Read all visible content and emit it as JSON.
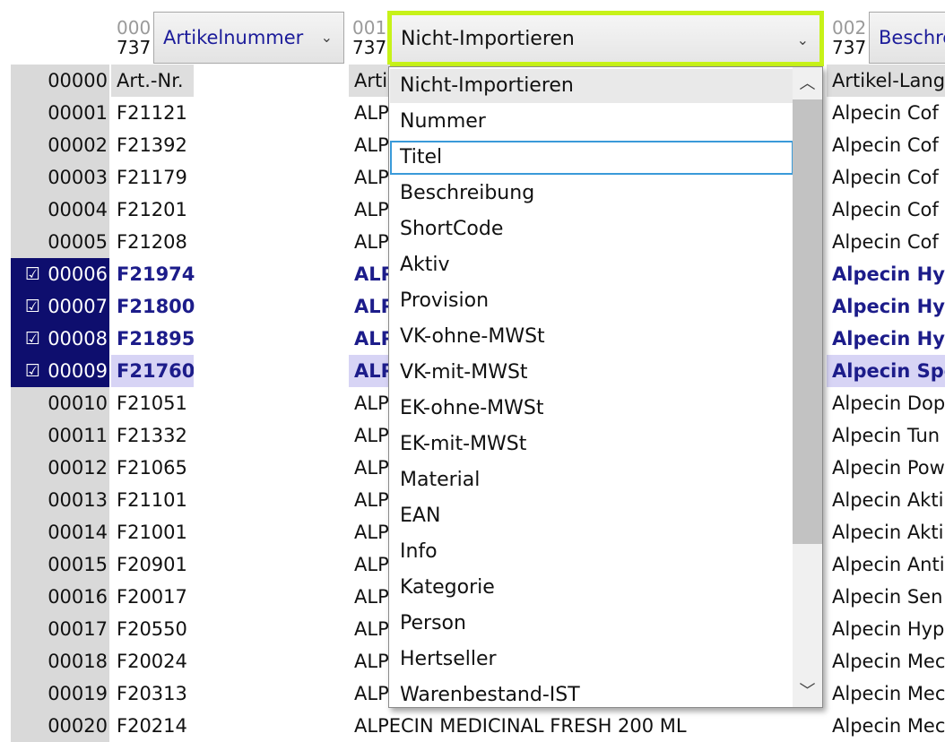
{
  "columns": [
    {
      "index": "000",
      "count": "737",
      "mapping": "Artikelnummer"
    },
    {
      "index": "001",
      "count": "737",
      "mapping": "Nicht-Importieren"
    },
    {
      "index": "002",
      "count": "737",
      "mapping": "Beschre"
    }
  ],
  "header_row": {
    "rownum": "00000",
    "c0": "Art.-Nr.",
    "c1": "Artikel",
    "c2": "Artikel-Lang"
  },
  "rows": [
    {
      "num": "00001",
      "c0": "F21121",
      "c1": "ALP",
      "c2": "Alpecin Cof",
      "selected": false
    },
    {
      "num": "00002",
      "c0": "F21392",
      "c1": "ALP",
      "c2": "Alpecin Cof",
      "selected": false
    },
    {
      "num": "00003",
      "c0": "F21179",
      "c1": "ALP",
      "c2": "Alpecin Cof",
      "selected": false
    },
    {
      "num": "00004",
      "c0": "F21201",
      "c1": "ALP",
      "c2": "Alpecin Cof",
      "selected": false
    },
    {
      "num": "00005",
      "c0": "F21208",
      "c1": "ALP",
      "c2": "Alpecin Cof",
      "selected": false
    },
    {
      "num": "00006",
      "c0": "F21974",
      "c1": "ALP",
      "c2": "Alpecin Hyl",
      "selected": true
    },
    {
      "num": "00007",
      "c0": "F21800",
      "c1": "ALP",
      "c2": "Alpecin Hyl",
      "selected": true
    },
    {
      "num": "00008",
      "c0": "F21895",
      "c1": "ALP",
      "c2": "Alpecin Hyl",
      "selected": true
    },
    {
      "num": "00009",
      "c0": "F21760",
      "c1": "ALP",
      "c2": "Alpecin Spo",
      "selected": true
    },
    {
      "num": "00010",
      "c0": "F21051",
      "c1": "ALP",
      "c2": "Alpecin Dop",
      "selected": false
    },
    {
      "num": "00011",
      "c0": "F21332",
      "c1": "ALP",
      "c2": "Alpecin Tun",
      "selected": false
    },
    {
      "num": "00012",
      "c0": "F21065",
      "c1": "ALP",
      "c2": "Alpecin Pow",
      "selected": false
    },
    {
      "num": "00013",
      "c0": "F21101",
      "c1": "ALP",
      "c2": "Alpecin Akti",
      "selected": false
    },
    {
      "num": "00014",
      "c0": "F21001",
      "c1": "ALP",
      "c2": "Alpecin Akti",
      "selected": false
    },
    {
      "num": "00015",
      "c0": "F20901",
      "c1": "ALP",
      "c2": "Alpecin Anti",
      "selected": false
    },
    {
      "num": "00016",
      "c0": "F20017",
      "c1": "ALP",
      "c2": "Alpecin Sen",
      "selected": false
    },
    {
      "num": "00017",
      "c0": "F20550",
      "c1": "ALP",
      "c2": "Alpecin Hyp",
      "selected": false
    },
    {
      "num": "00018",
      "c0": "F20024",
      "c1": "ALP",
      "c2": "Alpecin Mec",
      "selected": false
    },
    {
      "num": "00019",
      "c0": "F20313",
      "c1": "ALP",
      "c2": "Alpecin Mec",
      "selected": false
    },
    {
      "num": "00020",
      "c0": "F20214",
      "c1": "ALPECIN MEDICINAL FRESH 200 ML",
      "c2": "Alpecin Mec",
      "selected": false
    }
  ],
  "dropdown": {
    "options": [
      "Nicht-Importieren",
      "Nummer",
      "Titel",
      "Beschreibung",
      "ShortCode",
      "Aktiv",
      "Provision",
      "VK-ohne-MWSt",
      "VK-mit-MWSt",
      "EK-ohne-MWSt",
      "EK-mit-MWSt",
      "Material",
      "EAN",
      "Info",
      "Kategorie",
      "Person",
      "Hertseller",
      "Warenbestand-IST"
    ],
    "current_index": 0,
    "focus_index": 2
  },
  "icons": {
    "checkbox": "☑",
    "chevron_down": "⌄",
    "scroll_up": "︿",
    "scroll_down": "﹀"
  },
  "colors": {
    "active_border": "#c7f219",
    "selection_bg": "#0e0e6e",
    "focus_border": "#3a9ad9"
  }
}
